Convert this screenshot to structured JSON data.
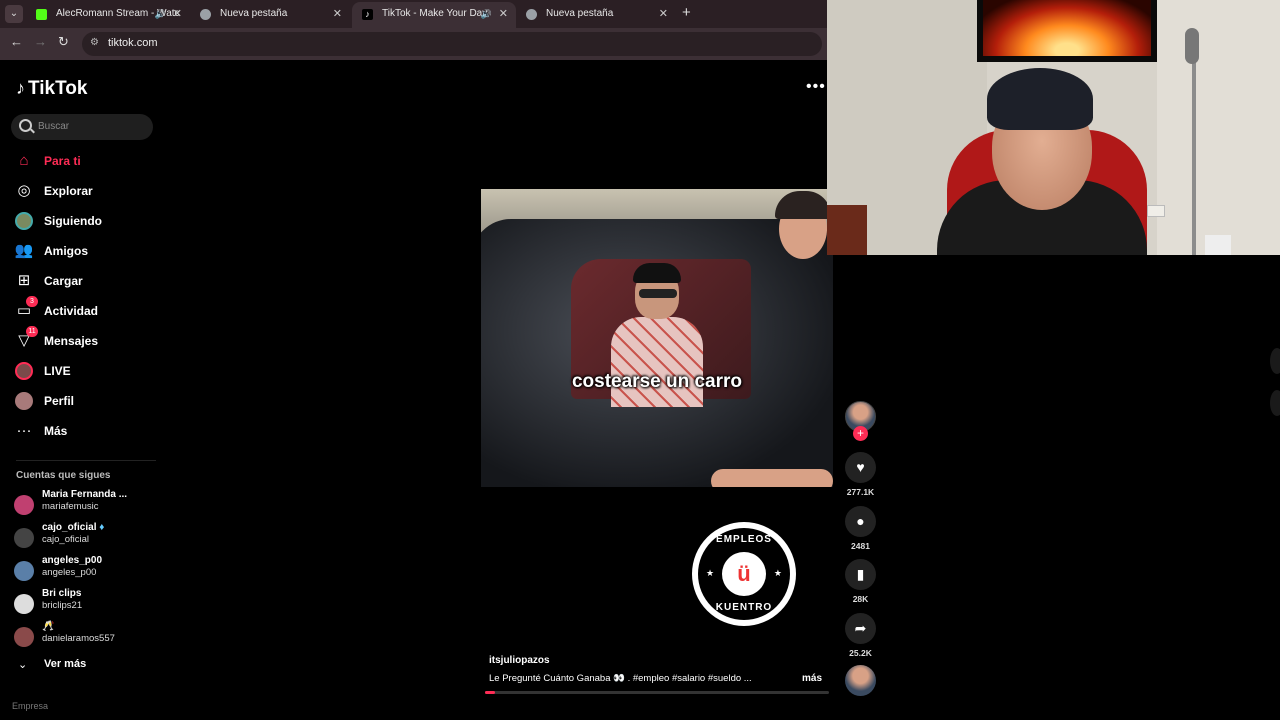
{
  "browser": {
    "tabs": [
      {
        "title": "AlecRomann Stream - Watc",
        "favicon_color": "#53fc18",
        "active": false,
        "muted": true
      },
      {
        "title": "Nueva pestaña",
        "favicon_color": "#9aa0a6",
        "active": false,
        "muted": false
      },
      {
        "title": "TikTok - Make Your Day",
        "favicon_color": "#000000",
        "active": true,
        "muted": true
      },
      {
        "title": "Nueva pestaña",
        "favicon_color": "#9aa0a6",
        "active": false,
        "muted": false
      }
    ],
    "url": "tiktok.com"
  },
  "sidebar": {
    "logo": "TikTok",
    "search_placeholder": "Buscar",
    "nav": [
      {
        "label": "Para ti",
        "icon": "home-icon",
        "active": true
      },
      {
        "label": "Explorar",
        "icon": "compass-icon",
        "active": false
      },
      {
        "label": "Siguiendo",
        "icon": "following-avatar-icon",
        "active": false
      },
      {
        "label": "Amigos",
        "icon": "friends-icon",
        "active": false
      },
      {
        "label": "Cargar",
        "icon": "upload-icon",
        "active": false
      },
      {
        "label": "Actividad",
        "icon": "activity-icon",
        "active": false,
        "badge": "3"
      },
      {
        "label": "Mensajes",
        "icon": "messages-icon",
        "active": false,
        "badge": "11"
      },
      {
        "label": "LIVE",
        "icon": "live-icon",
        "active": false
      },
      {
        "label": "Perfil",
        "icon": "profile-avatar-icon",
        "active": false
      },
      {
        "label": "Más",
        "icon": "more-dots-icon",
        "active": false
      }
    ],
    "following_header": "Cuentas que sigues",
    "following": [
      {
        "name": "Maria Fernanda ...",
        "username": "mariafemusic",
        "avatar_color": "#c04070"
      },
      {
        "name": "cajo_oficial",
        "username": "cajo_oficial",
        "avatar_color": "#444444"
      },
      {
        "name": "angeles_p00",
        "username": "angeles_p00",
        "avatar_color": "#5a7fa8"
      },
      {
        "name": "Bri clips",
        "username": "briclips21",
        "avatar_color": "#dddddd"
      },
      {
        "name": "",
        "username": "danielaramos557",
        "avatar_color": "#8a4a4a"
      }
    ],
    "see_more": "Ver más",
    "cutoff_text": "Empresa"
  },
  "video": {
    "caption_overlay": "costearse un carro",
    "author": "itsjuliopazos",
    "description": "Le Pregunté Cuánto Ganaba 👀 . #empleo #salario #sueldo ...",
    "more_label": "más",
    "progress_percent": 3,
    "brand_logo": {
      "top": "EMPLEOS",
      "bottom": "KUENTRO",
      "center": "ü"
    }
  },
  "actions": {
    "likes": "277.1K",
    "comments": "2481",
    "saves": "28K",
    "shares": "25.2K"
  },
  "colors": {
    "accent": "#fe2c55",
    "background": "#000000"
  }
}
